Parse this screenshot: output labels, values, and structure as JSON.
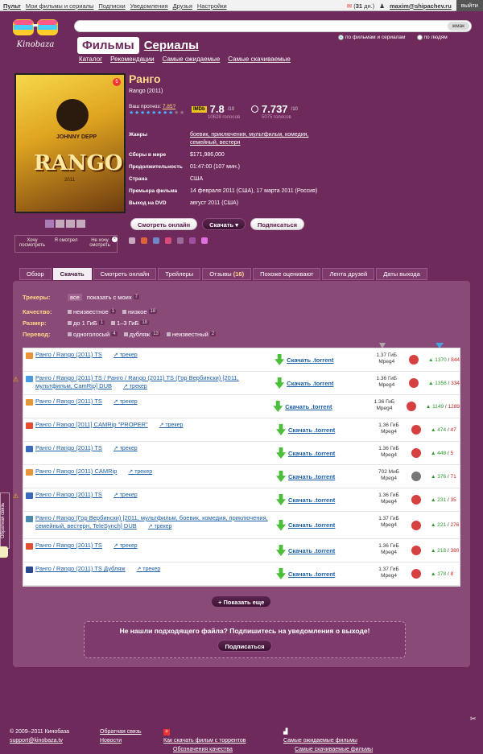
{
  "topbar": {
    "links": [
      "Пульт",
      "Мои фильмы и сериалы",
      "Подписки",
      "Уведомления",
      "Друзья",
      "Настройки"
    ],
    "msg_count": "31",
    "msg_suffix": "дн.",
    "user": "maxim@shipachev.ru",
    "exit": "выйти"
  },
  "logo": {
    "text": "Kinobaza"
  },
  "search": {
    "placeholder": "",
    "button": "жмак"
  },
  "search_scope": {
    "opt1": "по фильмам и сериалам",
    "opt2": "по людям",
    "selected": "по фильмам и сериалам"
  },
  "sections": {
    "films": "Фильмы",
    "series": "Сериалы"
  },
  "subnav": [
    "Каталог",
    "Рекомендации",
    "Самые ожидаемые",
    "Самые скачиваемые"
  ],
  "poster": {
    "actor": "JOHNNY DEPP",
    "title": "RANGO",
    "year": "2011",
    "badge": "5"
  },
  "watch_status": [
    "Хочу посмотреть",
    "Я смотрел",
    "Не хочу смотреть"
  ],
  "movie": {
    "title_ru": "Ранго",
    "title_orig": "Rango (2011)",
    "forecast_label": "Ваш прогноз:",
    "forecast_value": "7.85?",
    "stars_filled": 8,
    "stars_total": 10,
    "imdb": {
      "logo": "IMDb",
      "score": "7.8",
      "of": "/10",
      "votes": "10628 голосов"
    },
    "kp": {
      "score": "7.737",
      "of": "/10",
      "votes": "5075 голосов"
    }
  },
  "info": [
    {
      "k": "Жанры",
      "v": "боевик, приключения, мультфильм, комедия, семейный, вестерн"
    },
    {
      "k": "Сборы в мире",
      "v": "$171,986,000"
    },
    {
      "k": "Продолжительность",
      "v": "01:47:00 (107 мин.)"
    },
    {
      "k": "Страна",
      "v": "США"
    },
    {
      "k": "Премьера фильма",
      "v": "14 февраля 2011 (США), 17 марта 2011 (Россия)"
    },
    {
      "k": "Выход на DVD",
      "v": "август 2011 (США)"
    }
  ],
  "actions": {
    "watch": "Смотреть онлайн",
    "download": "Скачать",
    "subscribe": "Подписаться"
  },
  "share_colors": [
    "#c9a8c0",
    "#e0603a",
    "#6f86c9",
    "#d84a7c",
    "#9a6a9a",
    "#a04fa0",
    "#e070e0"
  ],
  "tabs": [
    {
      "label": "Обзор"
    },
    {
      "label": "Скачать",
      "active": true
    },
    {
      "label": "Смотреть онлайн"
    },
    {
      "label": "Трейлеры"
    },
    {
      "label": "Отзывы",
      "count": "(16)"
    },
    {
      "label": "Похоже оценивают"
    },
    {
      "label": "Лента друзей"
    },
    {
      "label": "Даты выхода"
    }
  ],
  "filters": {
    "trackers": {
      "label": "Трекеры:",
      "all": "все",
      "mine": "показать с моих",
      "mine_n": "7"
    },
    "quality": {
      "label": "Качество:",
      "items": [
        {
          "t": "неизвестное",
          "n": "1"
        },
        {
          "t": "низкое",
          "n": "18"
        }
      ]
    },
    "size": {
      "label": "Размер:",
      "items": [
        {
          "t": "до 1 ГиБ",
          "n": "1"
        },
        {
          "t": "1–3 ГиБ",
          "n": "18"
        }
      ]
    },
    "translation": {
      "label": "Перевод:",
      "items": [
        {
          "t": "одноголосый",
          "n": "4"
        },
        {
          "t": "дубляж",
          "n": "13"
        },
        {
          "t": "неизвестный",
          "n": "2"
        }
      ]
    }
  },
  "torrents": [
    {
      "name": "Ранго / Rango (2011) TS",
      "tracker": "трекер",
      "size": "1.37 ГиБ",
      "fmt": "Mpeg4",
      "seeds": "1370",
      "leech": "844",
      "icon": "#e8953a",
      "warn": false,
      "rate": "red"
    },
    {
      "name": "Ранго / Rango (2011) TS / Ранго / Rango (2011) TS (Гор Вербински) [2011, мультфильм, CamRip] DUB",
      "tracker": "трекер",
      "size": "1.36 ГиБ",
      "fmt": "Mpeg4",
      "seeds": "1356",
      "leech": "334",
      "icon": "#4a9ae0",
      "warn": true,
      "rate": "red"
    },
    {
      "name": "Ранго / Rango (2011) TS",
      "tracker": "трекер",
      "size": "1.36 ГиБ",
      "fmt": "Mpeg4",
      "seeds": "1149",
      "leech": "1289",
      "icon": "#e8953a",
      "warn": false,
      "rate": "red"
    },
    {
      "name": "Ранго / Rango [2011] CAMRip \"PROPER\"",
      "tracker": "трекер",
      "size": "1.36 ГиБ",
      "fmt": "Mpeg4",
      "seeds": "474",
      "leech": "47",
      "icon": "#e05030",
      "warn": false,
      "rate": "red"
    },
    {
      "name": "Ранго / Rango (2011) TS",
      "tracker": "трекер",
      "size": "1.36 ГиБ",
      "fmt": "Mpeg4",
      "seeds": "448",
      "leech": "5",
      "icon": "#3a6ab9",
      "warn": false,
      "rate": "red"
    },
    {
      "name": "Ранго / Rango (2011) CAMRip",
      "tracker": "трекер",
      "size": "702 МиБ",
      "fmt": "Mpeg4",
      "seeds": "376",
      "leech": "71",
      "icon": "#e8953a",
      "warn": false,
      "rate": "gray"
    },
    {
      "name": "Ранго / Rango (2011) TS",
      "tracker": "трекер",
      "size": "1.36 ГиБ",
      "fmt": "Mpeg4",
      "seeds": "231",
      "leech": "35",
      "icon": "#3a6ab9",
      "warn": true,
      "rate": "red"
    },
    {
      "name": "Ранго / Rango (Гор Вербински) [2011, мультфильм, боевик, комедия, приключения, семейный, вестерн, TeleSynch] DUB",
      "tracker": "трекер",
      "size": "1.37 ГиБ",
      "fmt": "Mpeg4",
      "seeds": "221",
      "leech": "276",
      "icon": "#4a8ab0",
      "warn": false,
      "rate": "red"
    },
    {
      "name": "Ранго / Rango (2011) TS",
      "tracker": "трекер",
      "size": "1.36 ГиБ",
      "fmt": "Mpeg4",
      "seeds": "218",
      "leech": "380",
      "icon": "#e05030",
      "warn": false,
      "rate": "red"
    },
    {
      "name": "Ранго / Rango (2011) TS Дубляж",
      "tracker": "трекер",
      "size": "1.37 ГиБ",
      "fmt": "Mpeg4",
      "seeds": "178",
      "leech": "8",
      "icon": "#2a4a90",
      "warn": false,
      "rate": "red"
    }
  ],
  "download_label": "Скачать .torrent",
  "more": "Показать еще",
  "notify": {
    "msg": "Не нашли подходящего файла? Подпишитесь на уведомления о выходе!",
    "button": "Подписаться"
  },
  "side_tab": "Обратная связь",
  "footer": {
    "copyright": "© 2009–2011 Кинобаза",
    "email": "support@kinobaza.tv",
    "feedback": "Обратная связь",
    "news": "Новости",
    "howto": "Как скачать фильм с торрентов",
    "quality": "Обозначения качества",
    "top_expected": "Самые ожидаемые фильмы",
    "top_downloaded": "Самые скачиваемые фильмы"
  }
}
